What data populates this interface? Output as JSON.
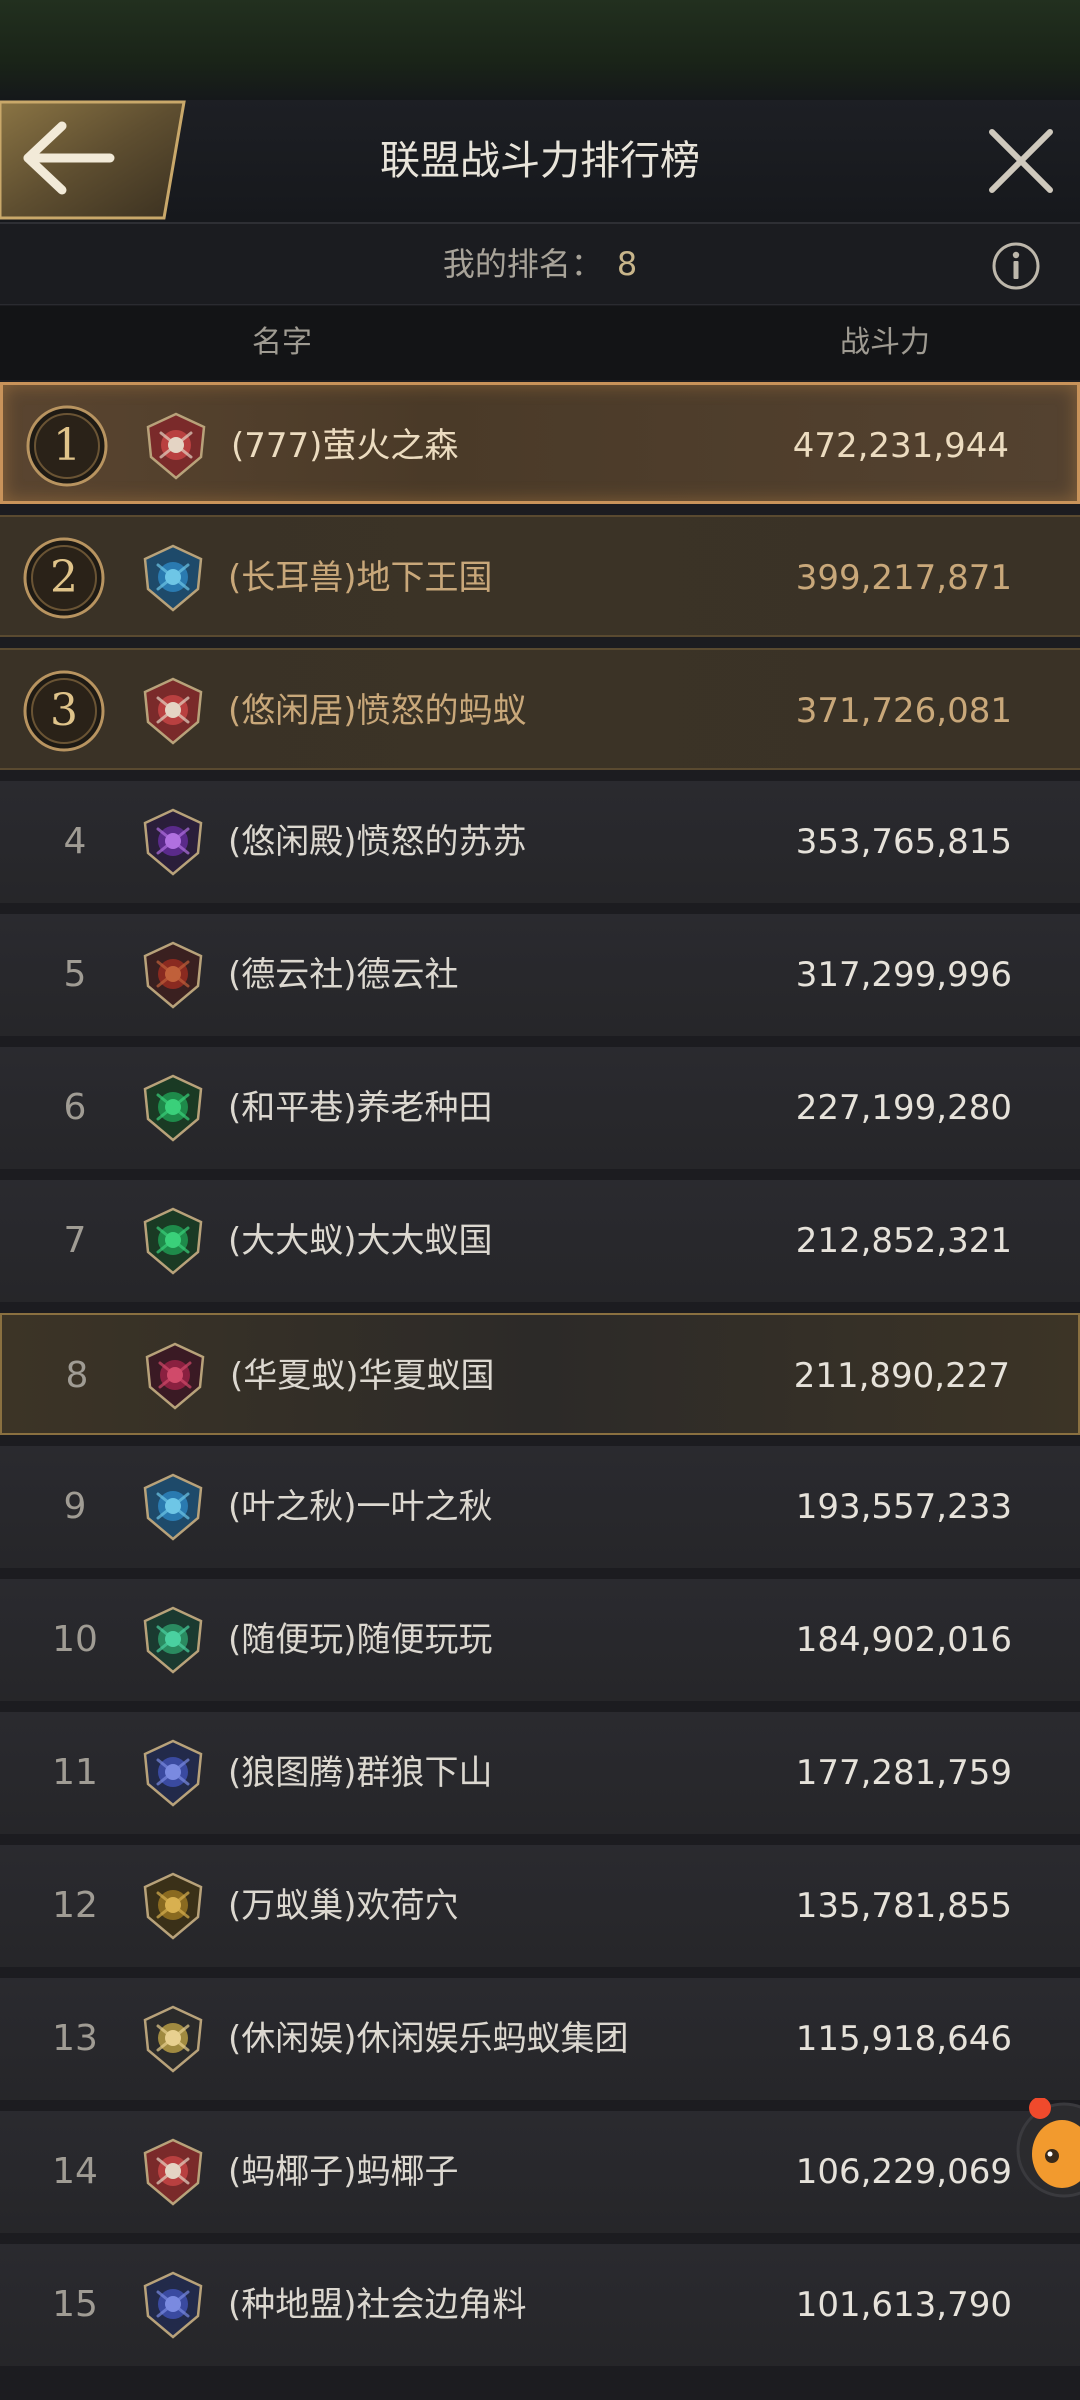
{
  "header": {
    "title": "联盟战斗力排行榜"
  },
  "my_rank": {
    "label": "我的排名：",
    "value": "8"
  },
  "columns": {
    "name": "名字",
    "power": "战斗力"
  },
  "rows": [
    {
      "rank": "1",
      "name": "(777)萤火之森",
      "power": "472,231,944",
      "emblem": "red-shield-emblem"
    },
    {
      "rank": "2",
      "name": "(长耳兽)地下王国",
      "power": "399,217,871",
      "emblem": "blue-scorpion-emblem"
    },
    {
      "rank": "3",
      "name": "(悠闲居)愤怒的蚂蚁",
      "power": "371,726,081",
      "emblem": "red-shield-emblem"
    },
    {
      "rank": "4",
      "name": "(悠闲殿)愤怒的苏苏",
      "power": "353,765,815",
      "emblem": "purple-spider-emblem"
    },
    {
      "rank": "5",
      "name": "(德云社)德云社",
      "power": "317,299,996",
      "emblem": "red-crossed-blades-emblem"
    },
    {
      "rank": "6",
      "name": "(和平巷)养老种田",
      "power": "227,199,280",
      "emblem": "green-clover-emblem"
    },
    {
      "rank": "7",
      "name": "(大大蚁)大大蚁国",
      "power": "212,852,321",
      "emblem": "green-clover-emblem"
    },
    {
      "rank": "8",
      "name": "(华夏蚁)华夏蚁国",
      "power": "211,890,227",
      "emblem": "crimson-ant-emblem"
    },
    {
      "rank": "9",
      "name": "(叶之秋)一叶之秋",
      "power": "193,557,233",
      "emblem": "blue-scorpion-emblem"
    },
    {
      "rank": "10",
      "name": "(随便玩)随便玩玩",
      "power": "184,902,016",
      "emblem": "green-leaf-emblem"
    },
    {
      "rank": "11",
      "name": "(狼图腾)群狼下山",
      "power": "177,281,759",
      "emblem": "blue-beetle-emblem"
    },
    {
      "rank": "12",
      "name": "(万蚁巢)欢荷穴",
      "power": "135,781,855",
      "emblem": "gold-ant-emblem"
    },
    {
      "rank": "13",
      "name": "(休闲娱)休闲娱乐蚂蚁集团",
      "power": "115,918,646",
      "emblem": "gold-snail-emblem"
    },
    {
      "rank": "14",
      "name": "(蚂椰子)蚂椰子",
      "power": "106,229,069",
      "emblem": "red-shield-emblem"
    },
    {
      "rank": "15",
      "name": "(种地盟)社会边角料",
      "power": "101,613,790",
      "emblem": "blue-beetle-emblem"
    }
  ],
  "colors": {
    "gold_accent": "#c9935a",
    "highlight_text": "#c9a87a",
    "row_bg": "#2a2a2f"
  }
}
